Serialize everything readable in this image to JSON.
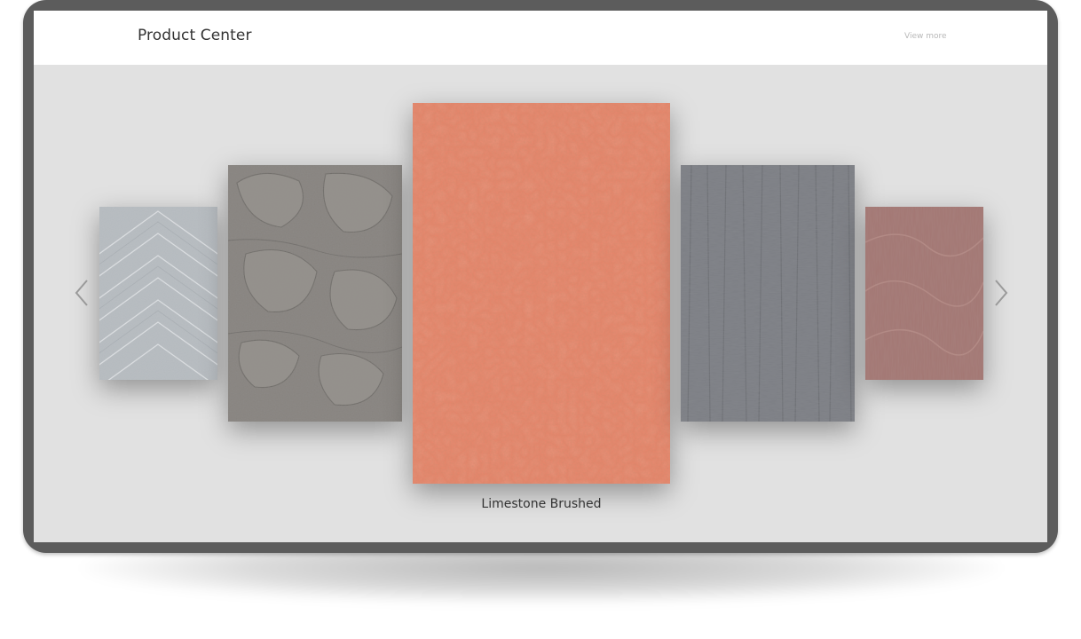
{
  "header": {
    "title": "Product Center",
    "view_more": "View more"
  },
  "carousel": {
    "active_caption": "Limestone Brushed",
    "items": [
      {
        "id": "white-wood-grain",
        "color": "#b3b8bc"
      },
      {
        "id": "taupe-relief",
        "color": "#888480"
      },
      {
        "id": "limestone-brushed",
        "color": "#e8846a"
      },
      {
        "id": "grey-ribbed",
        "color": "#7b7d83"
      },
      {
        "id": "rose-striated",
        "color": "#a07470"
      }
    ],
    "prev_icon": "chevron-left-icon",
    "next_icon": "chevron-right-icon"
  }
}
